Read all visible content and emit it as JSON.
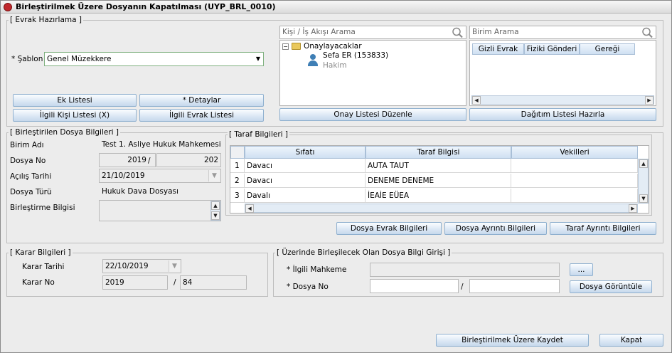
{
  "window": {
    "title": "Birleştirilmek Üzere Dosyanın Kapatılması (UYP_BRL_0010)"
  },
  "evrak": {
    "legend": "[ Evrak Hazırlama ]",
    "sablon_label": "* Şablon",
    "sablon_value": "Genel Müzekkere",
    "buttons": {
      "ek_listesi": "Ek Listesi",
      "detaylar": "* Detaylar",
      "ilgili_kisi": "İlgili Kişi Listesi (X)",
      "ilgili_evrak": "İlgili Evrak Listesi",
      "onay_listesi": "Onay Listesi Düzenle",
      "dagitim_listesi": "Dağıtım Listesi Hazırla"
    },
    "kisi_search_placeholder": "Kişi / İş Akışı Arama",
    "tree": {
      "root": "Onaylayacaklar",
      "person_name": "Sefa ER (153833)",
      "person_role": "Hakim"
    },
    "birim_search_placeholder": "Birim Arama",
    "birim_headers": [
      "Gizli Evrak",
      "Fiziki Gönderi",
      "Gereği"
    ]
  },
  "dosya": {
    "legend": "[ Birleştirilen Dosya Bilgileri ]",
    "birim_adi_label": "Birim Adı",
    "birim_adi": "Test 1. Asliye Hukuk Mahkemesi",
    "dosya_no_label": "Dosya No",
    "dosya_yil": "2019",
    "dosya_sep": "/",
    "dosya_sira": "202",
    "acilis_label": "Açılış Tarihi",
    "acilis": "21/10/2019",
    "turu_label": "Dosya Türü",
    "turu": "Hukuk Dava Dosyası",
    "birlestirme_label": "Birleştirme Bilgisi"
  },
  "taraf": {
    "legend": "[ Taraf Bilgileri ]",
    "headers": [
      "Sıfatı",
      "Taraf Bilgisi",
      "Vekilleri"
    ],
    "rows": [
      {
        "no": "1",
        "sifat": "Davacı",
        "taraf": "AUTA TAUT",
        "vekil": ""
      },
      {
        "no": "2",
        "sifat": "Davacı",
        "taraf": "DENEME DENEME",
        "vekil": ""
      },
      {
        "no": "3",
        "sifat": "Davalı",
        "taraf": "İEAİE EÜEA",
        "vekil": ""
      }
    ]
  },
  "detail_buttons": {
    "dosya_evrak": "Dosya Evrak Bilgileri",
    "dosya_ayrinti": "Dosya Ayrıntı Bilgileri",
    "taraf_ayrinti": "Taraf Ayrıntı Bilgileri"
  },
  "karar": {
    "legend": "[ Karar Bilgileri ]",
    "tarih_label": "Karar Tarihi",
    "tarih": "22/10/2019",
    "no_label": "Karar No",
    "no_yil": "2019",
    "no_sep": "/",
    "no_sira": "84"
  },
  "uzerinde": {
    "legend": "[ Üzerinde Birleşilecek Olan Dosya Bilgi Girişi ]",
    "mahkeme_label": "* İlgili Mahkeme",
    "mahkeme": "",
    "browse_button": "...",
    "dosya_no_label": "* Dosya No",
    "dosya_sep": "/",
    "goruntule_button": "Dosya Görüntüle"
  },
  "footer": {
    "kaydet": "Birleştirilmek Üzere Kaydet",
    "kapat": "Kapat"
  }
}
